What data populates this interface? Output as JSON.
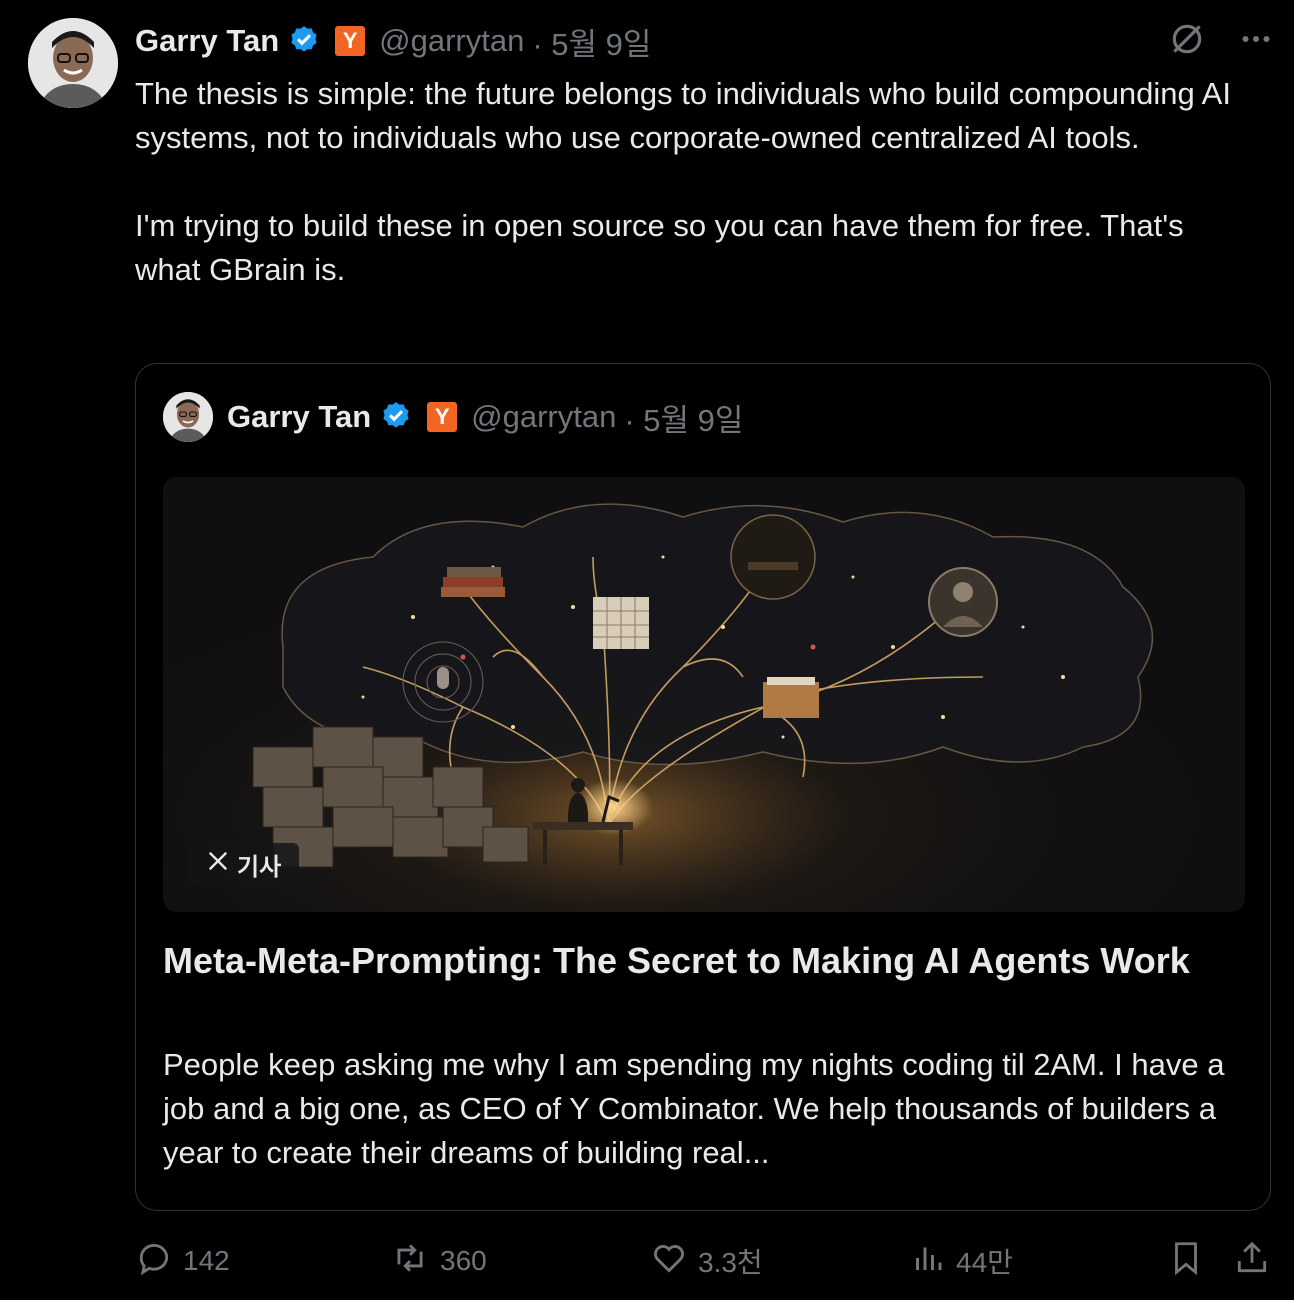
{
  "tweet": {
    "author_name": "Garry Tan",
    "handle": "@garrytan",
    "date": "· 5월 9일",
    "affiliation_badge": "Y",
    "paragraphs": [
      "The thesis is simple: the future belongs to individuals who build compounding AI systems, not to individuals who use corporate-owned centralized AI tools.",
      "I'm trying to build these in open source so you can have them for free. That's what GBrain is."
    ]
  },
  "quote": {
    "author_name": "Garry Tan",
    "handle": "@garrytan",
    "date": "· 5월 9일",
    "affiliation_badge": "Y",
    "badge_label": "기사",
    "article_title": "Meta-Meta-Prompting: The Secret to Making AI Agents Work",
    "article_desc": "People keep asking me why I am spending my nights coding til 2AM. I have a job and a big one, as CEO of Y Combinator. We help thousands of builders a year to create their dreams of building real..."
  },
  "actions": {
    "replies": "142",
    "reposts": "360",
    "likes": "3.3천",
    "views": "44만"
  },
  "icons": {
    "verified": "verified-badge-icon",
    "grok": "grok-icon",
    "more": "more-icon",
    "reply": "reply-icon",
    "repost": "repost-icon",
    "like": "like-icon",
    "views": "views-icon",
    "bookmark": "bookmark-icon",
    "share": "share-icon",
    "x_logo": "x-logo-icon"
  },
  "colors": {
    "background": "#000000",
    "text": "#e7e9ea",
    "muted": "#71767b",
    "verified": "#1d9bf0",
    "yc_orange": "#f26522",
    "border": "#2f3336"
  }
}
